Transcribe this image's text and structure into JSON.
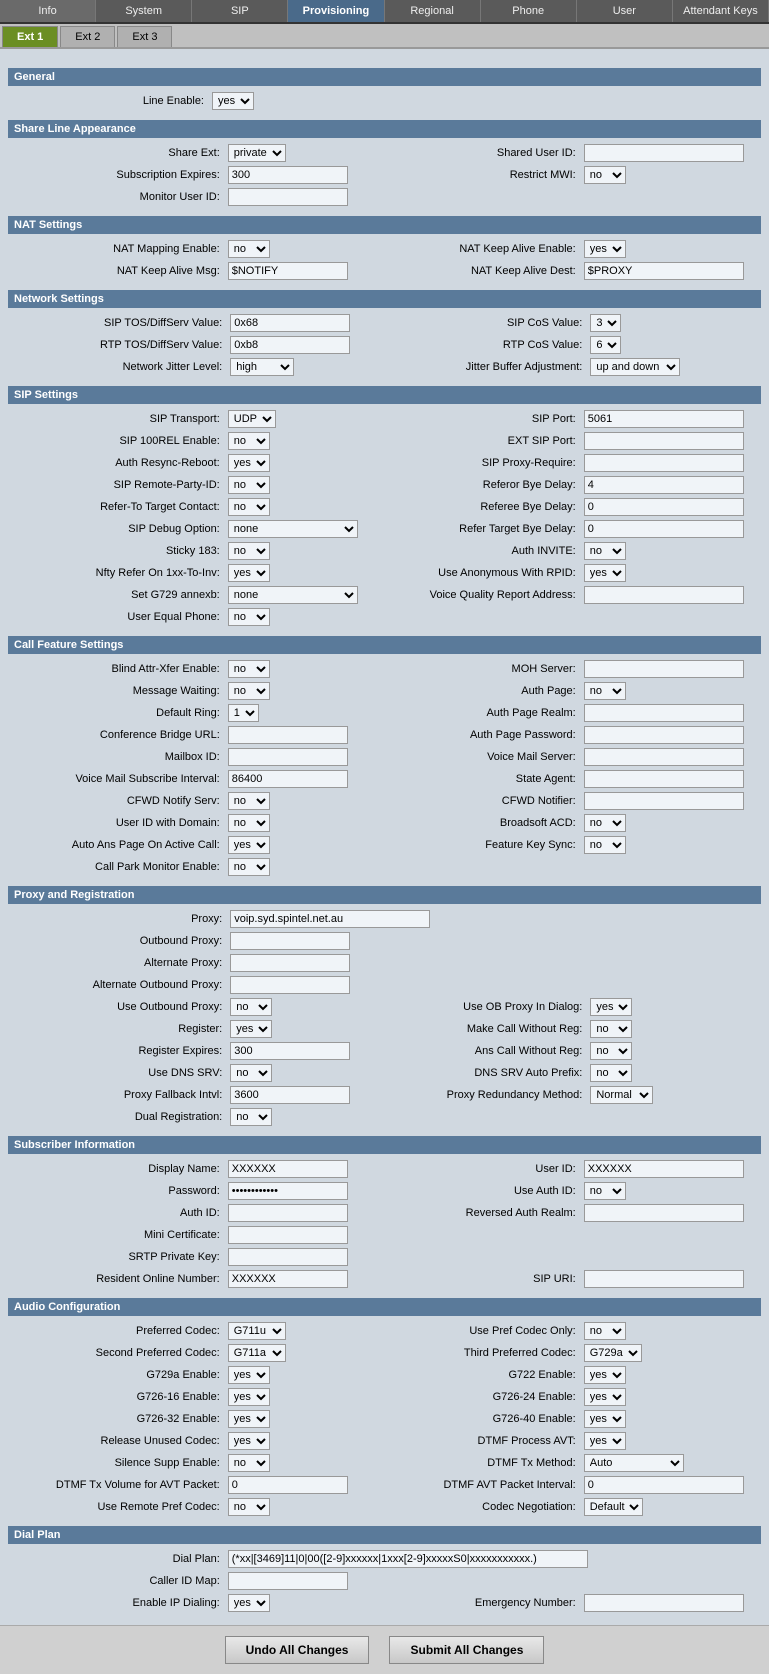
{
  "nav": {
    "tabs": [
      "Info",
      "System",
      "SIP",
      "Provisioning",
      "Regional",
      "Phone",
      "User",
      "Attendant Keys"
    ],
    "active_tab": "Provisioning"
  },
  "sub_tabs": [
    "Ext 1",
    "Ext 2",
    "Ext 3"
  ],
  "active_sub_tab": "Ext 1",
  "sections": {
    "general": "General",
    "share_line": "Share Line Appearance",
    "nat_settings": "NAT Settings",
    "network_settings": "Network Settings",
    "sip_settings": "SIP Settings",
    "call_feature": "Call Feature Settings",
    "proxy_reg": "Proxy and Registration",
    "subscriber": "Subscriber Information",
    "audio_config": "Audio Configuration",
    "dial_plan": "Dial Plan"
  },
  "general": {
    "line_enable_label": "Line Enable:",
    "line_enable_value": "yes"
  },
  "share_line": {
    "share_ext_label": "Share Ext:",
    "share_ext_value": "private",
    "shared_user_id_label": "Shared User ID:",
    "shared_user_id_value": "",
    "subscription_expires_label": "Subscription Expires:",
    "subscription_expires_value": "300",
    "restrict_mwi_label": "Restrict MWI:",
    "restrict_mwi_value": "no",
    "monitor_user_id_label": "Monitor User ID:",
    "monitor_user_id_value": ""
  },
  "nat": {
    "nat_mapping_label": "NAT Mapping Enable:",
    "nat_mapping_value": "no",
    "nat_keep_alive_enable_label": "NAT Keep Alive Enable:",
    "nat_keep_alive_enable_value": "yes",
    "nat_keep_alive_msg_label": "NAT Keep Alive Msg:",
    "nat_keep_alive_msg_value": "$NOTIFY",
    "nat_keep_alive_dest_label": "NAT Keep Alive Dest:",
    "nat_keep_alive_dest_value": "$PROXY"
  },
  "network": {
    "sip_tos_label": "SIP TOS/DiffServ Value:",
    "sip_tos_value": "0x68",
    "sip_cos_label": "SIP CoS Value:",
    "sip_cos_value": "3",
    "rtp_tos_label": "RTP TOS/DiffServ Value:",
    "rtp_tos_value": "0xb8",
    "rtp_cos_label": "RTP CoS Value:",
    "rtp_cos_value": "6",
    "network_jitter_label": "Network Jitter Level:",
    "network_jitter_value": "high",
    "jitter_buffer_label": "Jitter Buffer Adjustment:",
    "jitter_buffer_value": "up and down"
  },
  "sip": {
    "sip_transport_label": "SIP Transport:",
    "sip_transport_value": "UDP",
    "sip_port_label": "SIP Port:",
    "sip_port_value": "5061",
    "sip_100rel_label": "SIP 100REL Enable:",
    "sip_100rel_value": "no",
    "ext_sip_port_label": "EXT SIP Port:",
    "ext_sip_port_value": "",
    "auth_resync_label": "Auth Resync-Reboot:",
    "auth_resync_value": "yes",
    "sip_proxy_require_label": "SIP Proxy-Require:",
    "sip_proxy_require_value": "",
    "sip_remote_party_label": "SIP Remote-Party-ID:",
    "sip_remote_party_value": "no",
    "referor_bye_delay_label": "Referor Bye Delay:",
    "referor_bye_delay_value": "4",
    "refer_to_target_label": "Refer-To Target Contact:",
    "refer_to_target_value": "no",
    "referee_bye_delay_label": "Referee Bye Delay:",
    "referee_bye_delay_value": "0",
    "sip_debug_label": "SIP Debug Option:",
    "sip_debug_value": "none",
    "refer_target_bye_delay_label": "Refer Target Bye Delay:",
    "refer_target_bye_delay_value": "0",
    "sticky_183_label": "Sticky 183:",
    "sticky_183_value": "no",
    "auth_invite_label": "Auth INVITE:",
    "auth_invite_value": "no",
    "nfty_refer_label": "Nfty Refer On 1xx-To-Inv:",
    "nfty_refer_value": "yes",
    "use_anonymous_label": "Use Anonymous With RPID:",
    "use_anonymous_value": "yes",
    "set_g729_label": "Set G729 annexb:",
    "set_g729_value": "none",
    "voice_quality_label": "Voice Quality Report Address:",
    "voice_quality_value": "",
    "user_equal_phone_label": "User Equal Phone:",
    "user_equal_phone_value": "no"
  },
  "call_feature": {
    "blind_attr_label": "Blind Attr-Xfer Enable:",
    "blind_attr_value": "no",
    "moh_server_label": "MOH Server:",
    "moh_server_value": "",
    "message_waiting_label": "Message Waiting:",
    "message_waiting_value": "no",
    "auth_page_label": "Auth Page:",
    "auth_page_value": "no",
    "default_ring_label": "Default Ring:",
    "default_ring_value": "1",
    "auth_page_realm_label": "Auth Page Realm:",
    "auth_page_realm_value": "",
    "conference_bridge_label": "Conference Bridge URL:",
    "conference_bridge_value": "",
    "auth_page_password_label": "Auth Page Password:",
    "auth_page_password_value": "",
    "mailbox_id_label": "Mailbox ID:",
    "mailbox_id_value": "",
    "voice_mail_server_label": "Voice Mail Server:",
    "voice_mail_server_value": "",
    "voice_mail_subscribe_label": "Voice Mail Subscribe Interval:",
    "voice_mail_subscribe_value": "86400",
    "state_agent_label": "State Agent:",
    "state_agent_value": "",
    "cfwd_notify_label": "CFWD Notify Serv:",
    "cfwd_notify_value": "no",
    "cfwd_notifier_label": "CFWD Notifier:",
    "cfwd_notifier_value": "",
    "user_id_domain_label": "User ID with Domain:",
    "user_id_domain_value": "no",
    "broadsoft_acd_label": "Broadsoft ACD:",
    "broadsoft_acd_value": "no",
    "auto_ans_page_label": "Auto Ans Page On Active Call:",
    "auto_ans_page_value": "yes",
    "feature_key_sync_label": "Feature Key Sync:",
    "feature_key_sync_value": "no",
    "call_park_label": "Call Park Monitor Enable:",
    "call_park_value": "no"
  },
  "proxy": {
    "proxy_label": "Proxy:",
    "proxy_value": "voip.syd.spintel.net.au",
    "outbound_proxy_label": "Outbound Proxy:",
    "outbound_proxy_value": "",
    "alternate_proxy_label": "Alternate Proxy:",
    "alternate_proxy_value": "",
    "alternate_outbound_label": "Alternate Outbound Proxy:",
    "alternate_outbound_value": "",
    "use_outbound_proxy_label": "Use Outbound Proxy:",
    "use_outbound_proxy_value": "no",
    "use_ob_proxy_in_dialog_label": "Use OB Proxy In Dialog:",
    "use_ob_proxy_in_dialog_value": "yes",
    "register_label": "Register:",
    "register_value": "yes",
    "make_call_without_reg_label": "Make Call Without Reg:",
    "make_call_without_reg_value": "no",
    "register_expires_label": "Register Expires:",
    "register_expires_value": "300",
    "ans_call_without_reg_label": "Ans Call Without Reg:",
    "ans_call_without_reg_value": "no",
    "use_dns_srv_label": "Use DNS SRV:",
    "use_dns_srv_value": "no",
    "dns_srv_auto_prefix_label": "DNS SRV Auto Prefix:",
    "dns_srv_auto_prefix_value": "no",
    "proxy_fallback_label": "Proxy Fallback Intvl:",
    "proxy_fallback_value": "3600",
    "proxy_redundancy_label": "Proxy Redundancy Method:",
    "proxy_redundancy_value": "Normal",
    "dual_registration_label": "Dual Registration:",
    "dual_registration_value": "no"
  },
  "subscriber": {
    "display_name_label": "Display Name:",
    "display_name_value": "XXXXXX",
    "user_id_label": "User ID:",
    "user_id_value": "XXXXXX",
    "password_label": "Password:",
    "password_value": "************",
    "use_auth_id_label": "Use Auth ID:",
    "use_auth_id_value": "no",
    "auth_id_label": "Auth ID:",
    "auth_id_value": "",
    "reversed_auth_realm_label": "Reversed Auth Realm:",
    "reversed_auth_realm_value": "",
    "mini_certificate_label": "Mini Certificate:",
    "mini_certificate_value": "",
    "srtp_private_key_label": "SRTP Private Key:",
    "srtp_private_key_value": "",
    "resident_online_number_label": "Resident Online Number:",
    "resident_online_number_value": "XXXXXX",
    "sip_uri_label": "SIP URI:",
    "sip_uri_value": ""
  },
  "audio": {
    "preferred_codec_label": "Preferred Codec:",
    "preferred_codec_value": "G711u",
    "use_pref_codec_only_label": "Use Pref Codec Only:",
    "use_pref_codec_only_value": "no",
    "second_preferred_codec_label": "Second Preferred Codec:",
    "second_preferred_codec_value": "G711a",
    "third_preferred_codec_label": "Third Preferred Codec:",
    "third_preferred_codec_value": "G729a",
    "g729a_enable_label": "G729a Enable:",
    "g729a_enable_value": "yes",
    "g722_enable_label": "G722 Enable:",
    "g722_enable_value": "yes",
    "g726_16_enable_label": "G726-16 Enable:",
    "g726_16_enable_value": "yes",
    "g726_24_enable_label": "G726-24 Enable:",
    "g726_24_enable_value": "yes",
    "g726_32_enable_label": "G726-32 Enable:",
    "g726_32_enable_value": "yes",
    "g726_40_enable_label": "G726-40 Enable:",
    "g726_40_enable_value": "yes",
    "release_unused_codec_label": "Release Unused Codec:",
    "release_unused_codec_value": "yes",
    "dtmf_process_avt_label": "DTMF Process AVT:",
    "dtmf_process_avt_value": "yes",
    "silence_supp_enable_label": "Silence Supp Enable:",
    "silence_supp_enable_value": "no",
    "dtmf_tx_method_label": "DTMF Tx Method:",
    "dtmf_tx_method_value": "Auto",
    "dtmf_tx_volume_label": "DTMF Tx Volume for AVT Packet:",
    "dtmf_tx_volume_value": "0",
    "dtmf_avt_packet_interval_label": "DTMF AVT Packet Interval:",
    "dtmf_avt_packet_interval_value": "0",
    "use_remote_pref_codec_label": "Use Remote Pref Codec:",
    "use_remote_pref_codec_value": "no",
    "codec_negotiation_label": "Codec Negotiation:",
    "codec_negotiation_value": "Default"
  },
  "dial_plan": {
    "dial_plan_label": "Dial Plan:",
    "dial_plan_value": "(*xx|[3469]11|0|00([2-9]xxxxxx|1xxx[2-9]xxxxxS0|xxxxxxxxxxx.)",
    "caller_id_map_label": "Caller ID Map:",
    "caller_id_map_value": "",
    "enable_ip_dialing_label": "Enable IP Dialing:",
    "enable_ip_dialing_value": "yes",
    "emergency_number_label": "Emergency Number:",
    "emergency_number_value": ""
  },
  "buttons": {
    "undo_label": "Undo All Changes",
    "submit_label": "Submit All Changes"
  }
}
